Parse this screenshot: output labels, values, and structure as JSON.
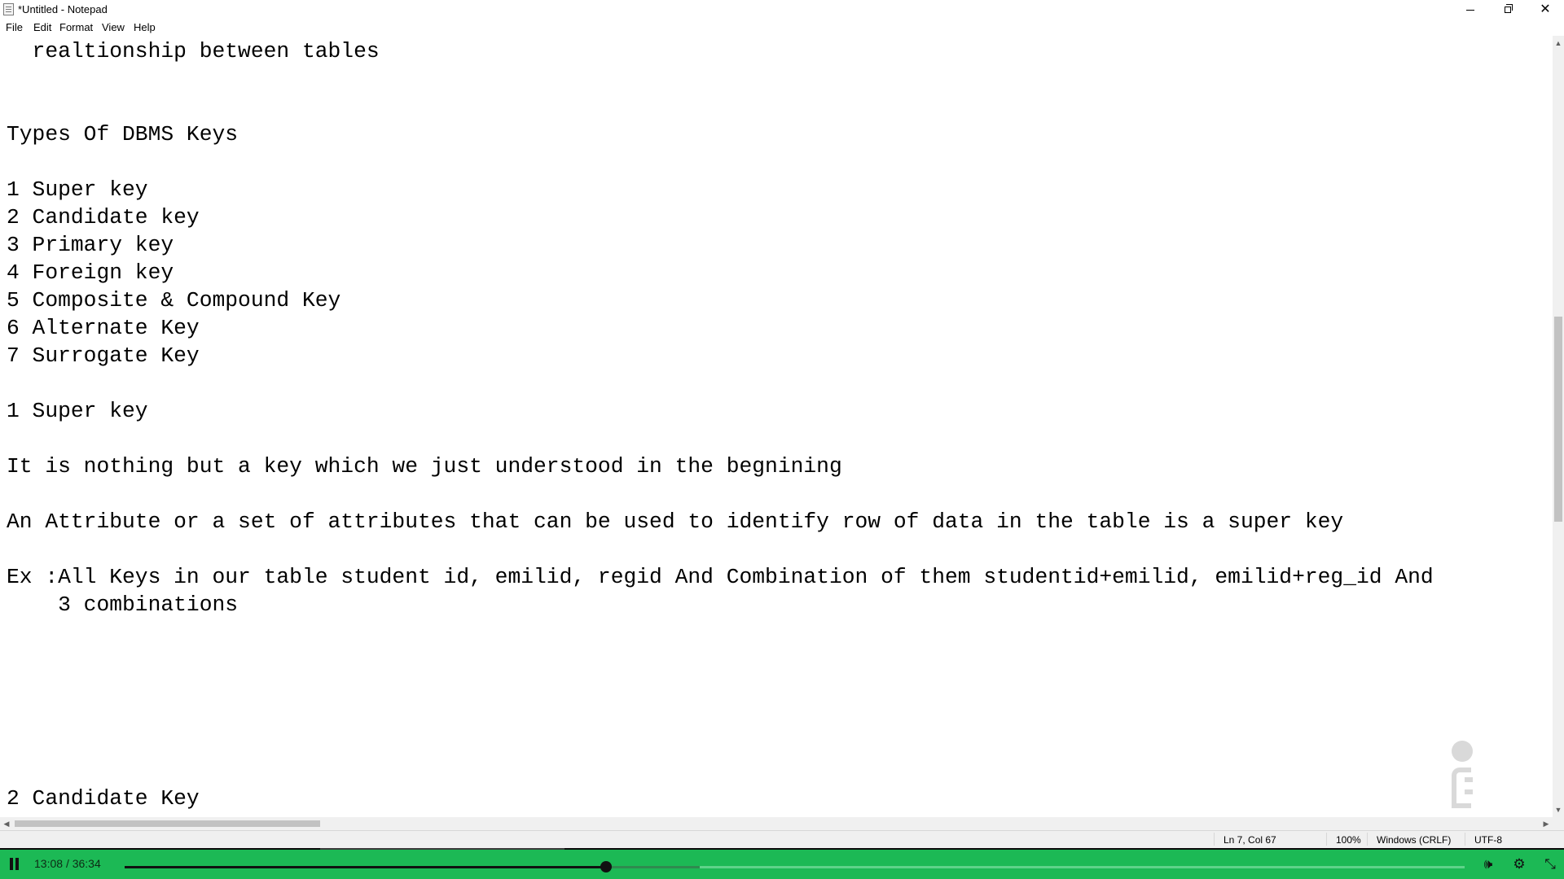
{
  "window": {
    "title": "*Untitled - Notepad",
    "controls": {
      "minimize": "minimize-icon",
      "maximize": "restore-icon",
      "close": "close-icon"
    }
  },
  "menu": {
    "items": [
      {
        "label": "File"
      },
      {
        "label": "Edit"
      },
      {
        "label": "Format"
      },
      {
        "label": "View"
      },
      {
        "label": "Help"
      }
    ]
  },
  "editor": {
    "lines": [
      "  realtionship between tables",
      "Types Of DBMS Keys",
      "1 Super key",
      "2 Candidate key",
      "3 Primary key",
      "4 Foreign key",
      "5 Composite & Compound Key",
      "6 Alternate Key",
      "7 Surrogate Key",
      "1 Super key",
      "It is nothing but a key which we just understood in the begnining",
      "An Attribute or a set of attributes that can be used to identify row of data in the table is a super key",
      "Ex :All Keys in our table student id, emilid, regid And Combination of them studentid+emilid, emilid+reg_id And",
      "    3 combinations",
      "2 Candidate Key"
    ]
  },
  "status": {
    "position": "Ln 7, Col 67",
    "zoom": "100%",
    "line_ending": "Windows (CRLF)",
    "encoding": "UTF-8"
  },
  "player": {
    "current_time": "13:08",
    "separator": "/",
    "duration": "36:34",
    "progress": 0.359,
    "icons": [
      "pause-icon",
      "volume-icon",
      "settings-gear-icon",
      "exit-fullscreen-icon"
    ]
  }
}
